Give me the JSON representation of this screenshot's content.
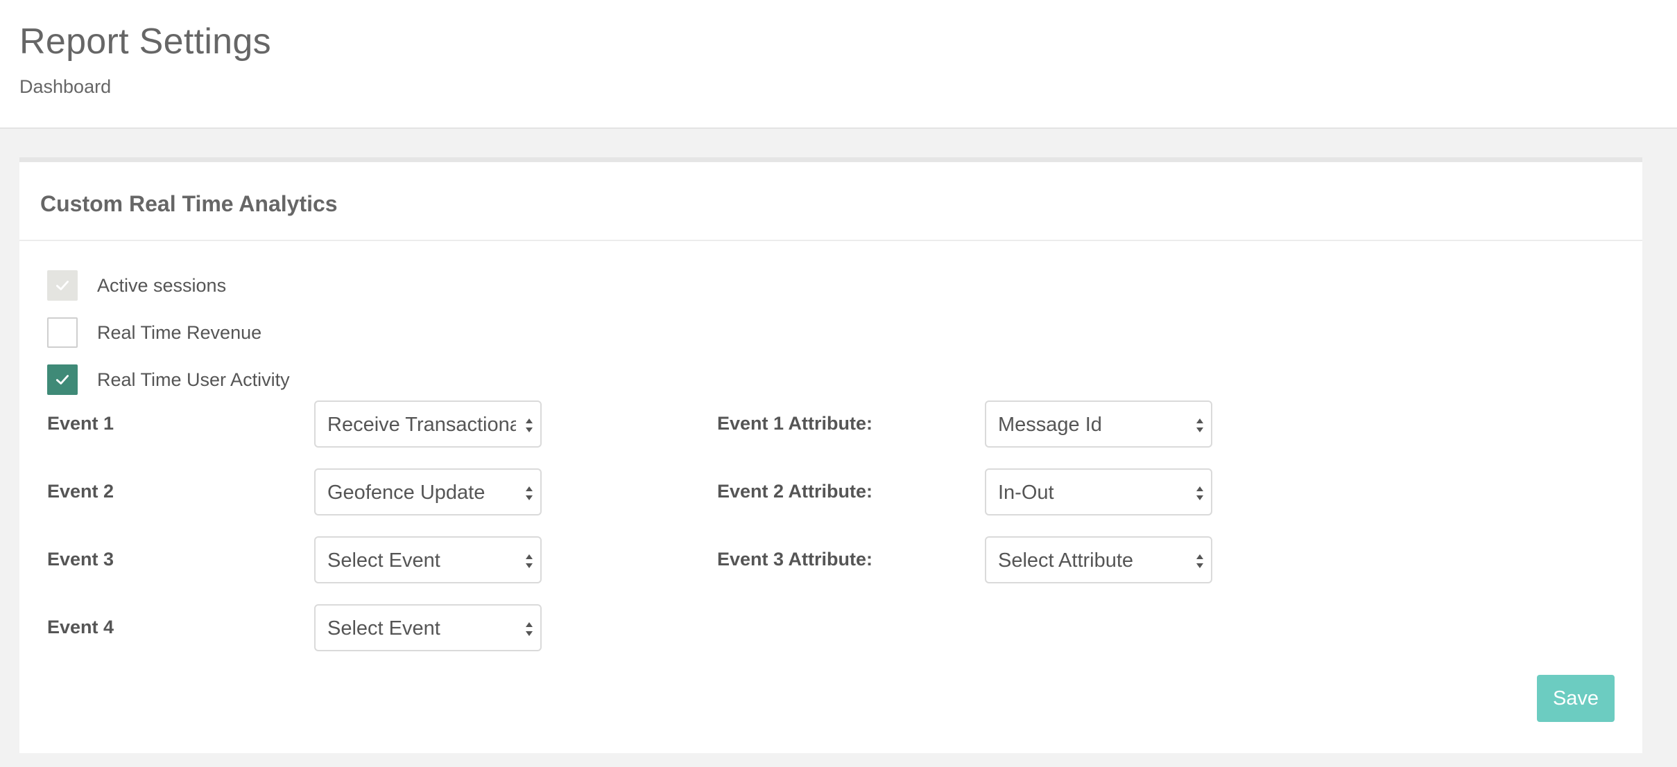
{
  "header": {
    "title": "Report Settings",
    "breadcrumb": "Dashboard"
  },
  "panel": {
    "title": "Custom Real Time Analytics",
    "checkboxes": [
      {
        "label": "Active sessions",
        "checked": true,
        "disabled": true
      },
      {
        "label": "Real Time Revenue",
        "checked": false,
        "disabled": false
      },
      {
        "label": "Real Time User Activity",
        "checked": true,
        "disabled": false
      }
    ],
    "events": [
      {
        "label": "Event 1",
        "value": "Receive Transactional"
      },
      {
        "label": "Event 2",
        "value": "Geofence Update"
      },
      {
        "label": "Event 3",
        "value": "Select Event"
      },
      {
        "label": "Event 4",
        "value": "Select Event"
      }
    ],
    "attributes": [
      {
        "label": "Event 1 Attribute:",
        "value": "Message Id"
      },
      {
        "label": "Event 2 Attribute:",
        "value": "In-Out"
      },
      {
        "label": "Event 3 Attribute:",
        "value": "Select Attribute"
      }
    ],
    "save_label": "Save"
  },
  "colors": {
    "checked": "#3f8a77",
    "save_button": "#6cccc1",
    "disabled_checkbox": "#e4e4e0"
  },
  "icons": {
    "checkbox_check": "check-icon",
    "select_arrows": "chevron-updown-icon"
  }
}
